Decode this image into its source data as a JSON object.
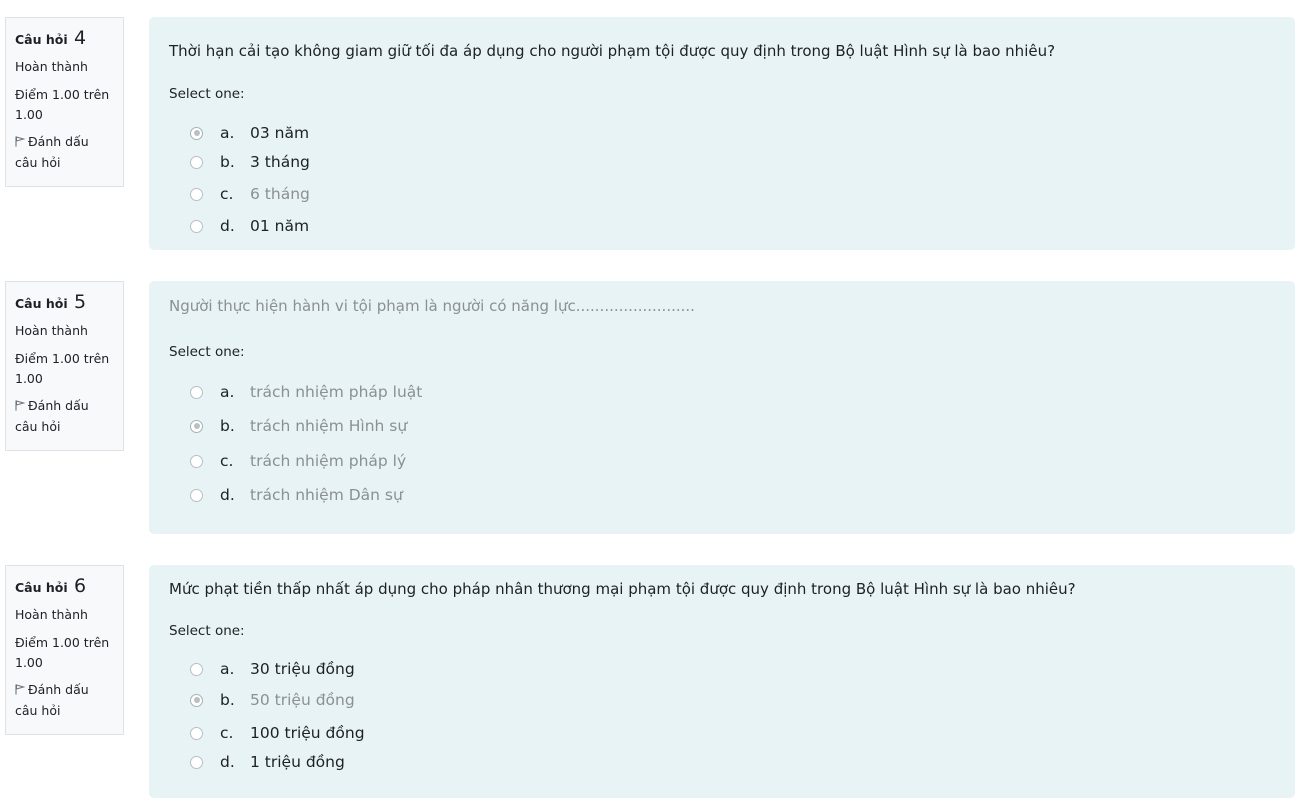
{
  "questions": [
    {
      "label": "Câu hỏi",
      "number": "4",
      "state": "Hoàn thành",
      "grade": "Điểm 1.00 trên 1.00",
      "flag_label": "Đánh dấu câu hỏi",
      "text": "Thời hạn cải tạo không giam giữ tối đa áp dụng cho người phạm tội được quy định trong Bộ luật Hình sự là bao nhiêu?",
      "prompt": "Select one:",
      "options": [
        {
          "letter": "a.",
          "text": "03 năm",
          "selected": true
        },
        {
          "letter": "b.",
          "text": "3 tháng",
          "selected": false
        },
        {
          "letter": "c.",
          "text": "6 tháng",
          "selected": false
        },
        {
          "letter": "d.",
          "text": "01 năm",
          "selected": false
        }
      ]
    },
    {
      "label": "Câu hỏi",
      "number": "5",
      "state": "Hoàn thành",
      "grade": "Điểm 1.00 trên 1.00",
      "flag_label": "Đánh dấu câu hỏi",
      "text": "Người thực hiện hành vi tội phạm là người có năng lực.........................",
      "prompt": "Select one:",
      "options": [
        {
          "letter": "a.",
          "text": "trách nhiệm pháp luật",
          "selected": false
        },
        {
          "letter": "b.",
          "text": "trách nhiệm Hình sự",
          "selected": true
        },
        {
          "letter": "c.",
          "text": "trách nhiệm pháp lý",
          "selected": false
        },
        {
          "letter": "d.",
          "text": "trách nhiệm Dân sự",
          "selected": false
        }
      ]
    },
    {
      "label": "Câu hỏi",
      "number": "6",
      "state": "Hoàn thành",
      "grade": "Điểm 1.00 trên 1.00",
      "flag_label": "Đánh dấu câu hỏi",
      "text": "Mức phạt tiền thấp nhất áp dụng cho pháp nhân thương mại phạm tội được quy định trong Bộ luật Hình sự là bao nhiêu?",
      "prompt": "Select one:",
      "options": [
        {
          "letter": "a.",
          "text": "30 triệu đồng",
          "selected": false
        },
        {
          "letter": "b.",
          "text": "50 triệu đồng",
          "selected": true
        },
        {
          "letter": "c.",
          "text": "100 triệu đồng",
          "selected": false
        },
        {
          "letter": "d.",
          "text": "1 triệu đồng",
          "selected": false
        }
      ]
    }
  ],
  "colors": {
    "content_bg": "#e7f3f5",
    "info_bg": "#f8f9fa",
    "muted_text": "#8a9094"
  }
}
